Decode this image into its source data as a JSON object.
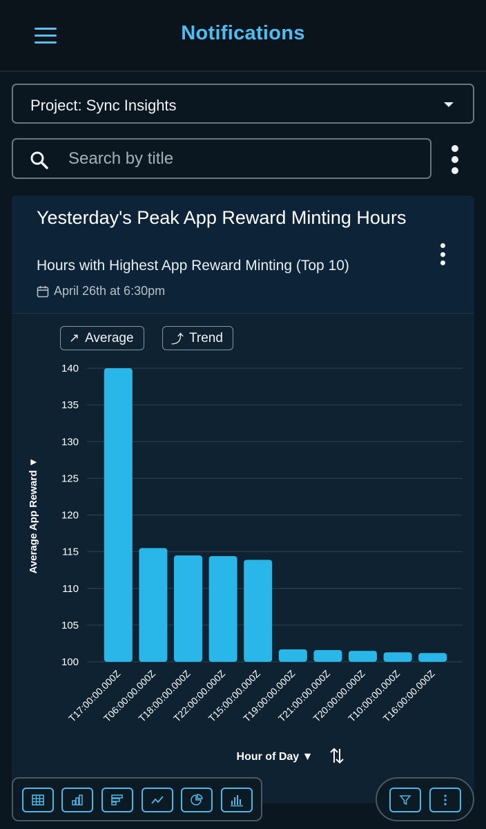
{
  "header": {
    "title": "Notifications",
    "menu_icon": "hamburger-menu-icon"
  },
  "project": {
    "label": "Project: Sync Insights"
  },
  "search": {
    "placeholder": "Search by title"
  },
  "card": {
    "title": "Yesterday's Peak App Reward Minting Hours",
    "subtitle": "Hours with Highest App Reward Minting (Top 10)",
    "date": "April 26th at 6:30pm"
  },
  "chips": {
    "average": "Average",
    "trend": "Trend"
  },
  "colors": {
    "accent": "#4ebdf3",
    "bar": "#29b6e8",
    "background": "#0b1720"
  },
  "chart_data": {
    "type": "bar",
    "categories": [
      "T17:00:00.000Z",
      "T06:00:00.000Z",
      "T18:00:00.000Z",
      "T22:00:00.000Z",
      "T15:00:00.000Z",
      "T19:00:00.000Z",
      "T21:00:00.000Z",
      "T20:00:00.000Z",
      "T10:00:00.000Z",
      "T16:00:00.000Z"
    ],
    "values": [
      140,
      115.5,
      114.5,
      114.4,
      113.9,
      101.7,
      101.6,
      101.5,
      101.3,
      101.2
    ],
    "xlabel": "Hour of Day ▼",
    "ylabel": "Average App Reward ▼",
    "ylim": [
      100,
      140
    ],
    "yticks": [
      100,
      105,
      110,
      115,
      120,
      125,
      130,
      135,
      140
    ],
    "grid": true,
    "legend": "none"
  },
  "toolbar": {
    "left_tools": [
      "table-view-icon",
      "column-chart-icon",
      "bar-chart-icon",
      "line-chart-icon",
      "pie-chart-icon",
      "histogram-icon"
    ],
    "right_tools": [
      "filter-icon",
      "more-options-icon"
    ]
  }
}
